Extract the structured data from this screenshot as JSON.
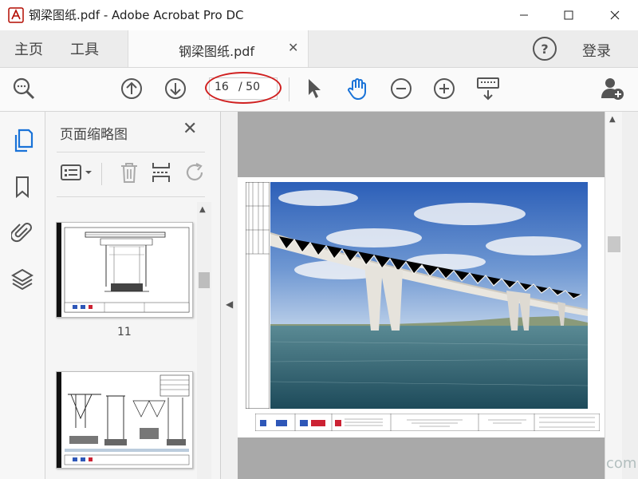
{
  "window": {
    "title": "钢梁图纸.pdf - Adobe Acrobat Pro DC"
  },
  "tabs": {
    "home": "主页",
    "tools": "工具",
    "document": "钢梁图纸.pdf",
    "login": "登录"
  },
  "toolbar": {
    "page_current": "16",
    "page_total": "/ 50",
    "icons": [
      "search-zoom-icon",
      "arrow-up-icon",
      "arrow-down-icon",
      "select-cursor-icon",
      "hand-tool-icon",
      "zoom-out-icon",
      "zoom-in-icon",
      "keyboard-icon",
      "add-user-icon"
    ],
    "active_color": "#1a73d8",
    "annotation_color": "#d02020"
  },
  "thumbnails": {
    "panel_title": "页面缩略图",
    "thumb_label": "11"
  },
  "watermark": "com"
}
